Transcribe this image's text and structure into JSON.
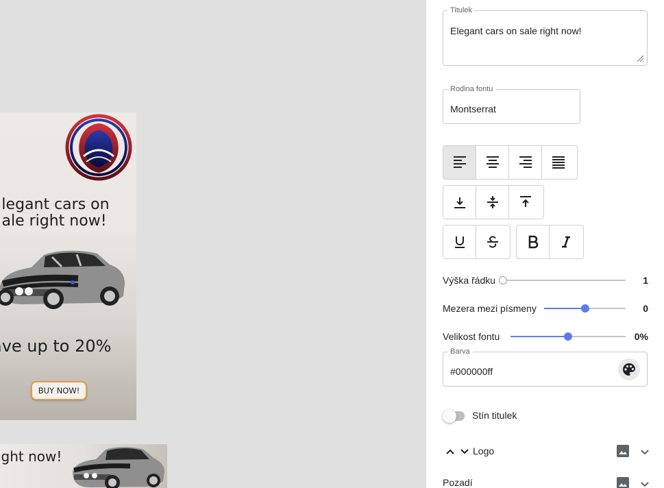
{
  "preview": {
    "tall_banner": {
      "headline_line1": "legant cars on",
      "headline_line2": "ale right now!",
      "subline": "ave up to 20%",
      "button_label": "BUY NOW!"
    },
    "wide_banner": {
      "text": "ight now!"
    }
  },
  "panel": {
    "title_field": {
      "label": "Titulek",
      "value": "Elegant cars on sale right now!"
    },
    "font_family": {
      "label": "Rodina fontu",
      "value": "Montserrat"
    },
    "align_buttons": [
      "align-left",
      "align-center",
      "align-right",
      "align-justify"
    ],
    "align_active": "align-left",
    "valign_buttons": [
      "align-bottom",
      "align-middle",
      "align-top"
    ],
    "decoration_buttons": [
      "underline",
      "strikethrough"
    ],
    "style_buttons": [
      "bold",
      "italic"
    ],
    "line_height": {
      "label": "Výška řádku",
      "value": "1",
      "level": 0
    },
    "letter_spacing": {
      "label": "Mezera mezi písmeny",
      "value": "0",
      "level": 0.5
    },
    "font_size": {
      "label": "Velikost fontu",
      "value": "0%",
      "level": 0.5
    },
    "color": {
      "label": "Barva",
      "value": "#000000ff"
    },
    "shadow_toggle": {
      "label": "Stín titulek",
      "on": false
    },
    "logo_section": {
      "label": "Logo"
    },
    "background_section": {
      "label": "Pozadí"
    }
  },
  "colors": {
    "accent": "#5b7cf0",
    "button_border": "#e59a47",
    "logo_red": "#b3262a",
    "logo_blue": "#1c2a8c"
  }
}
